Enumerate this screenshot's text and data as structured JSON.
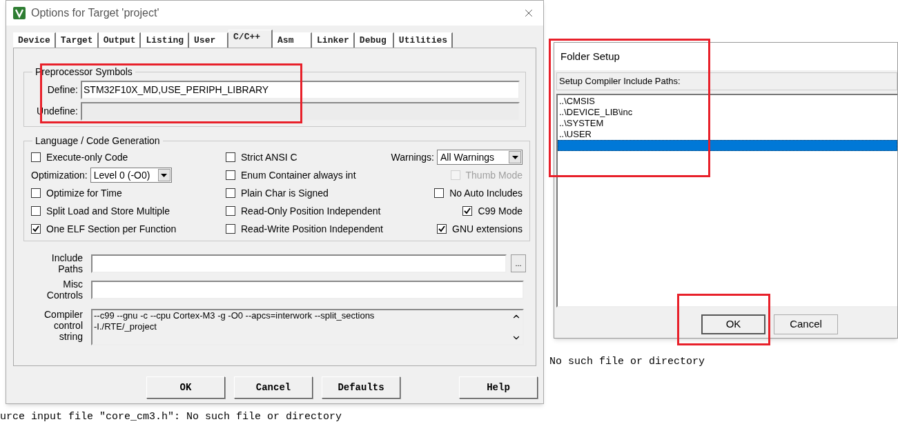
{
  "background_output": [
    {
      "text": "No such file or directory"
    },
    {
      "text": "urce input file \"core_cm3.h\": No such file or directory"
    }
  ],
  "options_dialog": {
    "title": "Options for Target 'project'",
    "tabs": [
      {
        "label": "Device",
        "selected": false
      },
      {
        "label": "Target",
        "selected": false
      },
      {
        "label": "Output",
        "selected": false
      },
      {
        "label": "Listing",
        "selected": false
      },
      {
        "label": "User",
        "selected": false
      },
      {
        "label": "C/C++",
        "selected": true
      },
      {
        "label": "Asm",
        "selected": false
      },
      {
        "label": "Linker",
        "selected": false
      },
      {
        "label": "Debug",
        "selected": false
      },
      {
        "label": "Utilities",
        "selected": false
      }
    ],
    "preprocessor": {
      "title": "Preprocessor Symbols",
      "fields": [
        {
          "label": "Define:",
          "value": "STM32F10X_MD,USE_PERIPH_LIBRARY",
          "disabled": false
        },
        {
          "label": "Undefine:",
          "disabled": true
        }
      ]
    },
    "language": {
      "title": "Language / Code Generation",
      "columns": [
        [
          {
            "kind": "checkbox",
            "label": "Execute-only Code",
            "checked": false,
            "disabled": false
          },
          {
            "kind": "select",
            "label": "Optimization:",
            "value": "Level 0 (-O0)"
          },
          {
            "kind": "checkbox",
            "label": "Optimize for Time",
            "checked": false,
            "disabled": false
          },
          {
            "kind": "checkbox",
            "label": "Split Load and Store Multiple",
            "checked": false,
            "disabled": false
          },
          {
            "kind": "checkbox",
            "label": "One ELF Section per Function",
            "checked": true,
            "disabled": false
          }
        ],
        [
          {
            "kind": "checkbox",
            "label": "Strict ANSI C",
            "checked": false,
            "disabled": false
          },
          {
            "kind": "checkbox",
            "label": "Enum Container always int",
            "checked": false,
            "disabled": false
          },
          {
            "kind": "checkbox",
            "label": "Plain Char is Signed",
            "checked": false,
            "disabled": false
          },
          {
            "kind": "checkbox",
            "label": "Read-Only Position Independent",
            "checked": false,
            "disabled": false
          },
          {
            "kind": "checkbox",
            "label": "Read-Write Position Independent",
            "checked": false,
            "disabled": false
          }
        ],
        [
          {
            "kind": "select",
            "label": "Warnings:",
            "value": "All Warnings"
          },
          {
            "kind": "checkbox",
            "label": "Thumb Mode",
            "checked": false,
            "disabled": true
          },
          {
            "kind": "checkbox",
            "label": "No Auto Includes",
            "checked": false,
            "disabled": false
          },
          {
            "kind": "checkbox",
            "label": "C99 Mode",
            "checked": true,
            "disabled": false
          },
          {
            "kind": "checkbox",
            "label": "GNU extensions",
            "checked": true,
            "disabled": false
          }
        ]
      ]
    },
    "include_paths": {
      "label": [
        "Include",
        "Paths"
      ],
      "browse_button": "..."
    },
    "misc_controls": {
      "label": [
        "Misc",
        "Controls"
      ]
    },
    "compiler_control_string": {
      "label": [
        "Compiler",
        "control",
        "string"
      ],
      "lines": [
        "--c99 --gnu -c --cpu Cortex-M3 -g -O0 --apcs=interwork --split_sections",
        "-I./RTE/_project"
      ]
    },
    "buttons": [
      "OK",
      "Cancel",
      "Defaults",
      "Help"
    ]
  },
  "folder_setup": {
    "title": "Folder Setup",
    "header": "Setup Compiler Include Paths:",
    "paths": [
      {
        "text": "..\\CMSIS",
        "selected": false
      },
      {
        "text": "..\\DEVICE_LIB\\inc",
        "selected": false
      },
      {
        "text": "..\\SYSTEM",
        "selected": false
      },
      {
        "text": "..\\USER",
        "selected": false
      }
    ],
    "empty_row": {
      "selected": true
    },
    "buttons": [
      "OK",
      "Cancel"
    ]
  }
}
